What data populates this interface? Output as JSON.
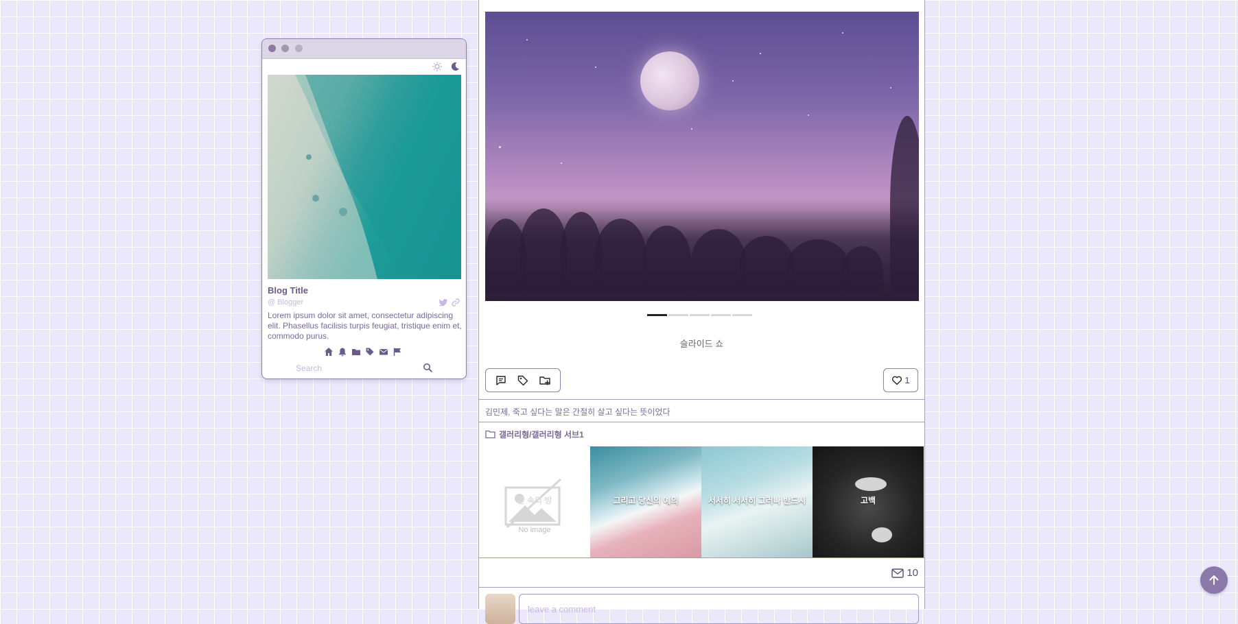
{
  "profile": {
    "title": "Blog Title",
    "author": "@ Blogger",
    "description": "Lorem ipsum dolor sit amet, consectetur adipiscing elit. Phasellus facilisis turpis feugiat, tristique enim et, commodo purus.",
    "search_placeholder": "Search",
    "mode_icons": [
      "sun-icon",
      "moon-icon"
    ],
    "social_icons": [
      "twitter-icon",
      "link-icon"
    ],
    "nav_icons": [
      "home-icon",
      "bell-icon",
      "folder-icon",
      "tag-icon",
      "envelope-icon",
      "flag-icon"
    ]
  },
  "post": {
    "slideshow_caption": "슬라이드 쇼",
    "slide_count": 5,
    "active_slide": 1,
    "likes": "1",
    "tagline": "김민제, 죽고 싶다는 말은 간절히 살고 싶다는 뜻이었다",
    "category": "갤러리형/갤러리형 서브1",
    "toolbar_icons": [
      "comment-icon",
      "tag-icon",
      "folder-add-icon"
    ],
    "related": [
      {
        "label": "간 속의 방",
        "image": "No image"
      },
      {
        "label": "그리고 당신의 예의",
        "image": "sea"
      },
      {
        "label": "서서히 서서히 그러나 반드시",
        "image": "sea"
      },
      {
        "label": "고백",
        "image": "doves"
      }
    ],
    "no_image_text": "No image",
    "mail_count": "10",
    "comment_placeholder": "leave a comment"
  },
  "colors": {
    "accent": "#8a78a8",
    "background": "#ece8fb",
    "text": "#5a4a7a"
  }
}
